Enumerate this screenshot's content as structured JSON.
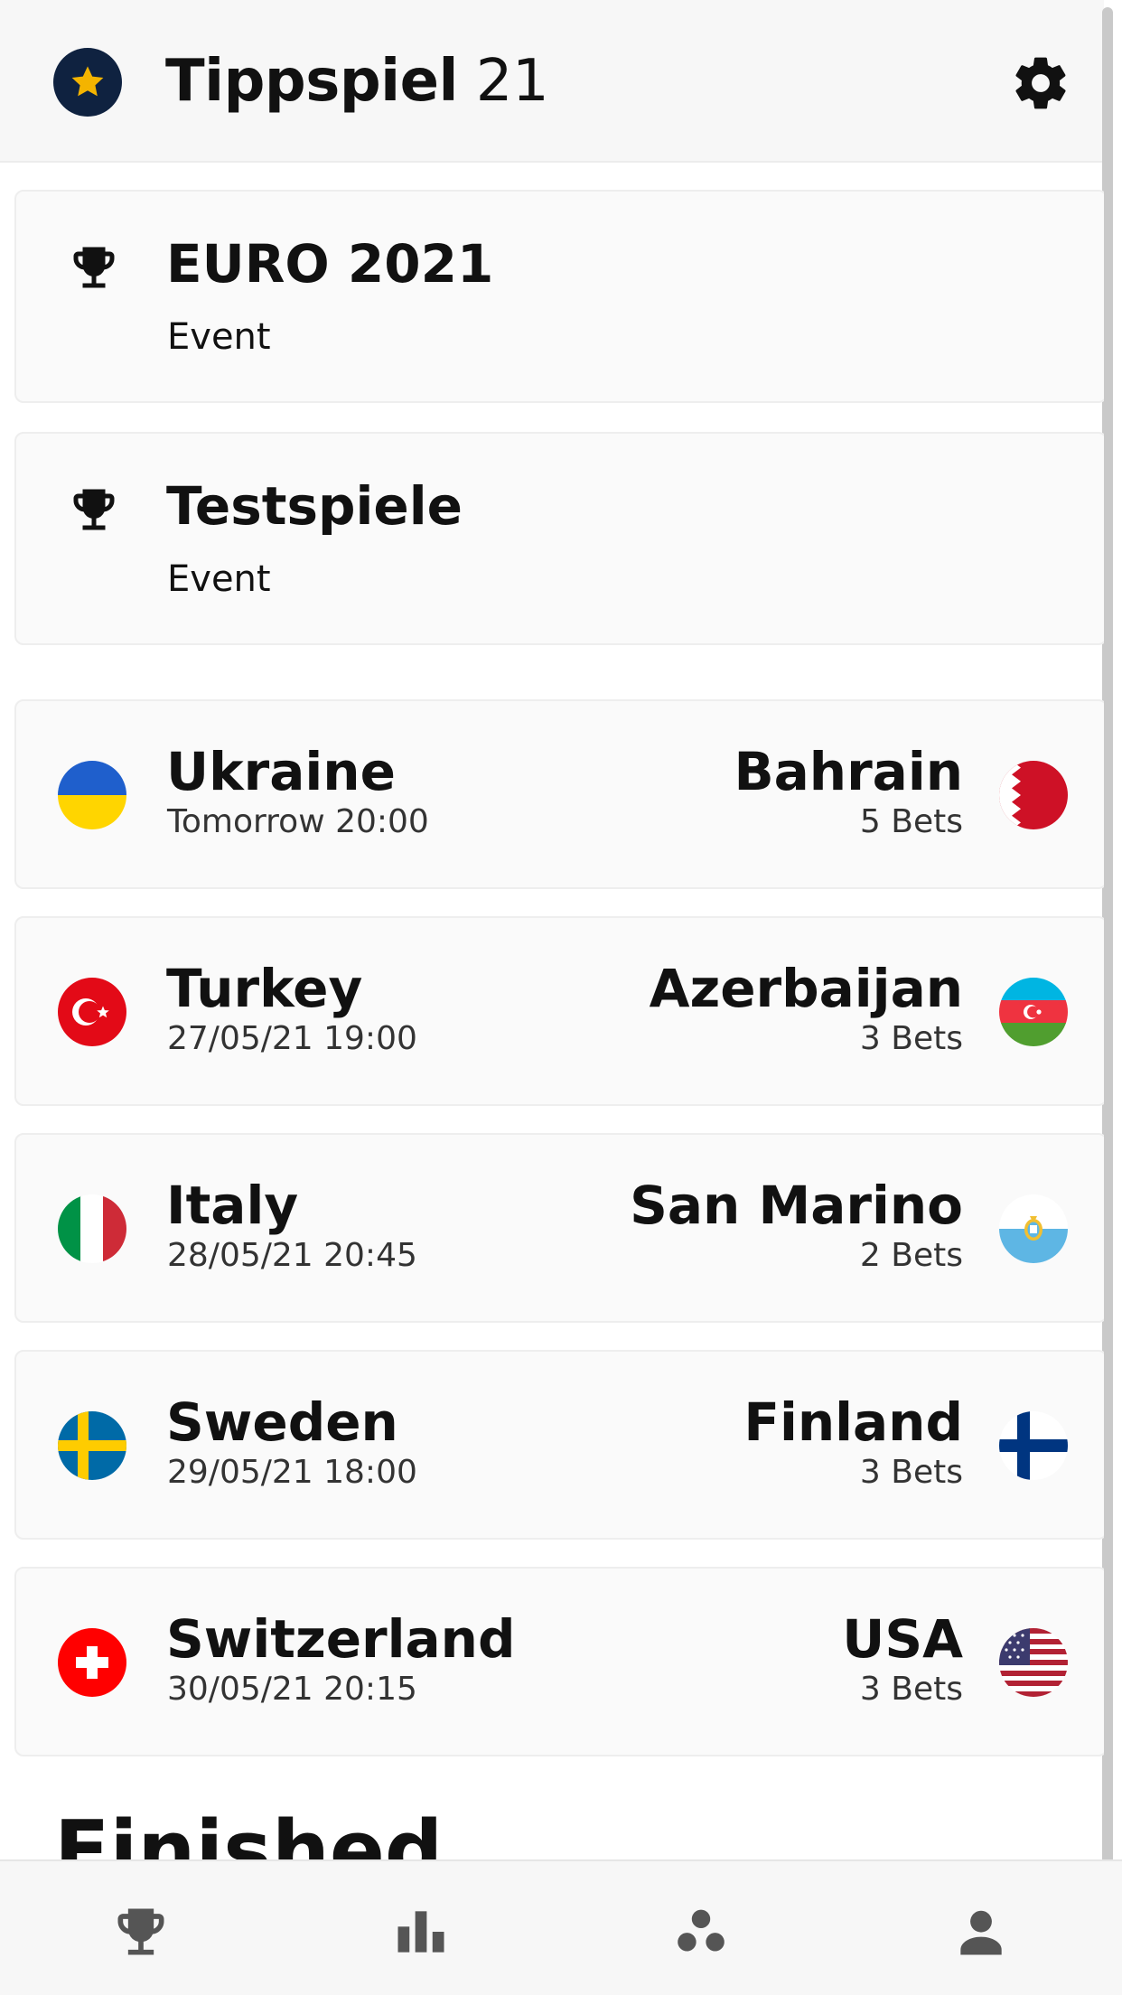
{
  "header": {
    "app_name_bold": "Tippspiel",
    "app_name_light": " 21",
    "logo_icon": "star-badge-icon",
    "settings_icon": "gear-icon",
    "colors": {
      "logo_bg": "#0f2240",
      "logo_star": "#f4b400"
    }
  },
  "events": [
    {
      "name": "EURO 2021",
      "type": "Event",
      "icon": "trophy-icon"
    },
    {
      "name": "Testspiele",
      "type": "Event",
      "icon": "trophy-icon"
    }
  ],
  "matches": [
    {
      "home": "Ukraine",
      "date": "Tomorrow 20:00",
      "away": "Bahrain",
      "bets": "5 Bets",
      "home_flag": "ukraine-flag-icon",
      "away_flag": "bahrain-flag-icon"
    },
    {
      "home": "Turkey",
      "date": "27/05/21 19:00",
      "away": "Azerbaijan",
      "bets": "3 Bets",
      "home_flag": "turkey-flag-icon",
      "away_flag": "azerbaijan-flag-icon"
    },
    {
      "home": "Italy",
      "date": "28/05/21 20:45",
      "away": "San Marino",
      "bets": "2 Bets",
      "home_flag": "italy-flag-icon",
      "away_flag": "san-marino-flag-icon"
    },
    {
      "home": "Sweden",
      "date": "29/05/21 18:00",
      "away": "Finland",
      "bets": "3 Bets",
      "home_flag": "sweden-flag-icon",
      "away_flag": "finland-flag-icon"
    },
    {
      "home": "Switzerland",
      "date": "30/05/21 20:15",
      "away": "USA",
      "bets": "3 Bets",
      "home_flag": "switzerland-flag-icon",
      "away_flag": "usa-flag-icon"
    }
  ],
  "sections": {
    "finished_title": "Finished"
  },
  "bottom_nav": [
    {
      "icon": "trophy-icon"
    },
    {
      "icon": "bar-chart-icon"
    },
    {
      "icon": "group-icon"
    },
    {
      "icon": "person-icon"
    }
  ]
}
